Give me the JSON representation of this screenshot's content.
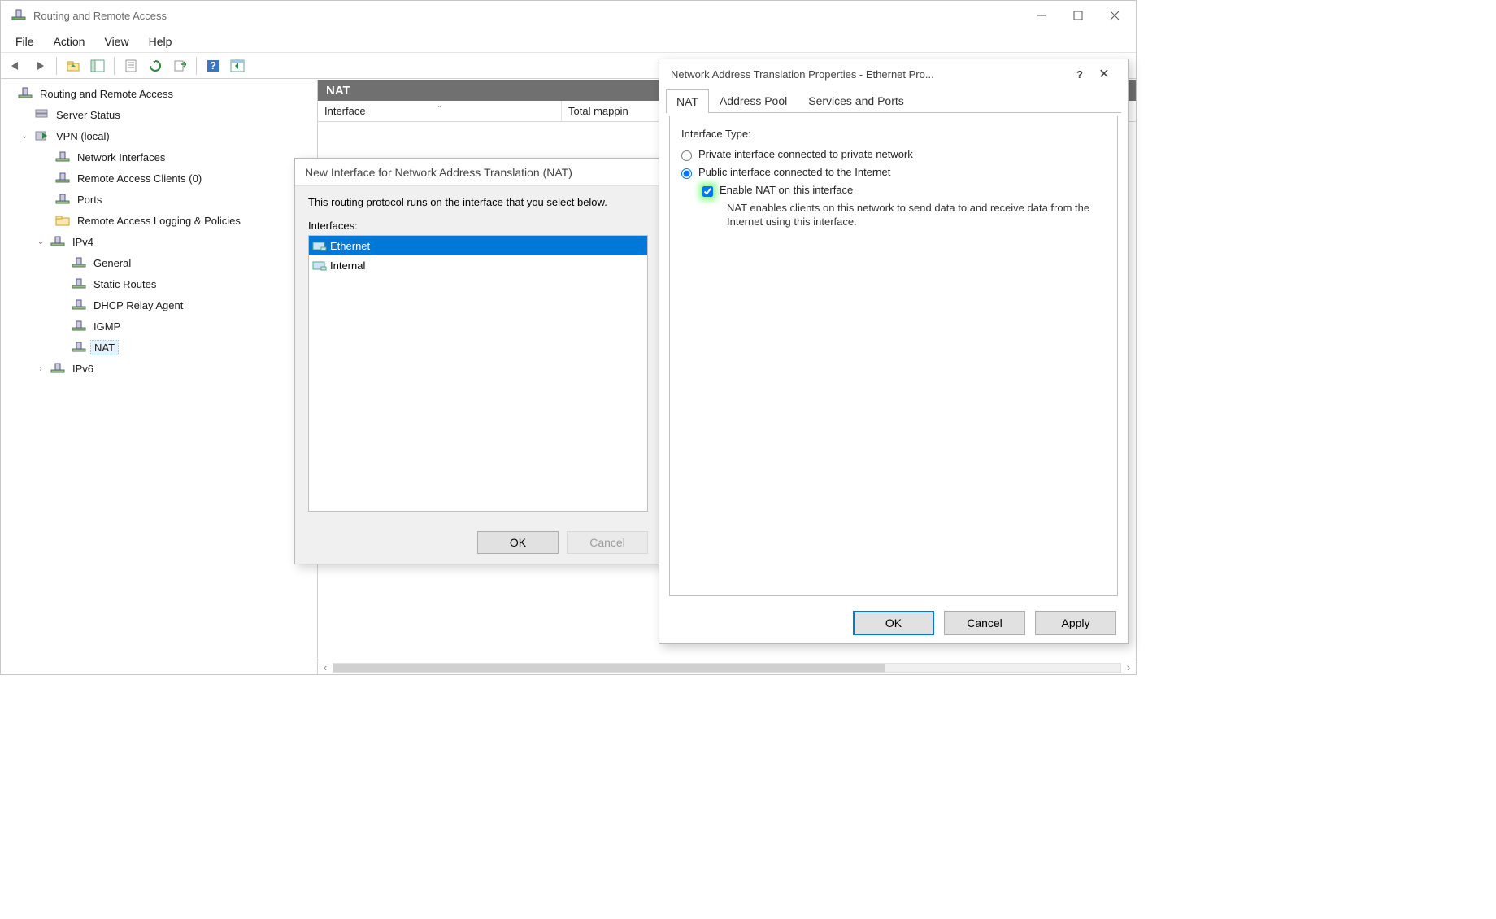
{
  "window": {
    "title": "Routing and Remote Access",
    "min_tooltip": "Minimize",
    "max_tooltip": "Maximize",
    "close_tooltip": "Close"
  },
  "menu": {
    "file": "File",
    "action": "Action",
    "view": "View",
    "help": "Help"
  },
  "toolbar": {
    "back": "Back",
    "forward": "Forward",
    "up": "Up one level",
    "show_hide": "Show/Hide Console Tree",
    "properties": "Properties",
    "refresh": "Refresh",
    "export": "Export List",
    "help": "Help",
    "showall": "Show All"
  },
  "tree": {
    "root": "Routing and Remote Access",
    "server_status": "Server Status",
    "vpn": "VPN (local)",
    "net_ifaces": "Network Interfaces",
    "rac": "Remote Access Clients (0)",
    "ports": "Ports",
    "logging": "Remote Access Logging & Policies",
    "ipv4": "IPv4",
    "general": "General",
    "static_routes": "Static Routes",
    "dhcp_relay": "DHCP Relay Agent",
    "igmp": "IGMP",
    "nat": "NAT",
    "ipv6": "IPv6"
  },
  "content": {
    "header": "NAT",
    "col_interface": "Interface",
    "col_total": "Total mappin"
  },
  "dlg_newiface": {
    "title": "New Interface for Network Address Translation (NAT)",
    "desc": "This routing protocol runs on the interface that you select below.",
    "label": "Interfaces:",
    "items": [
      "Ethernet",
      "Internal"
    ],
    "ok": "OK",
    "cancel": "Cancel"
  },
  "dlg_props": {
    "title": "Network Address Translation Properties - Ethernet Pro...",
    "help": "?",
    "close": "✕",
    "tab_nat": "NAT",
    "tab_pool": "Address Pool",
    "tab_services": "Services and Ports",
    "iface_type": "Interface Type:",
    "radio_private": "Private interface connected to private network",
    "radio_public": "Public interface connected to the Internet",
    "chk_enable": "Enable NAT on this interface",
    "chk_desc": "NAT enables clients on this network to send data to and receive data from the Internet using this interface.",
    "ok": "OK",
    "cancel": "Cancel",
    "apply": "Apply"
  }
}
